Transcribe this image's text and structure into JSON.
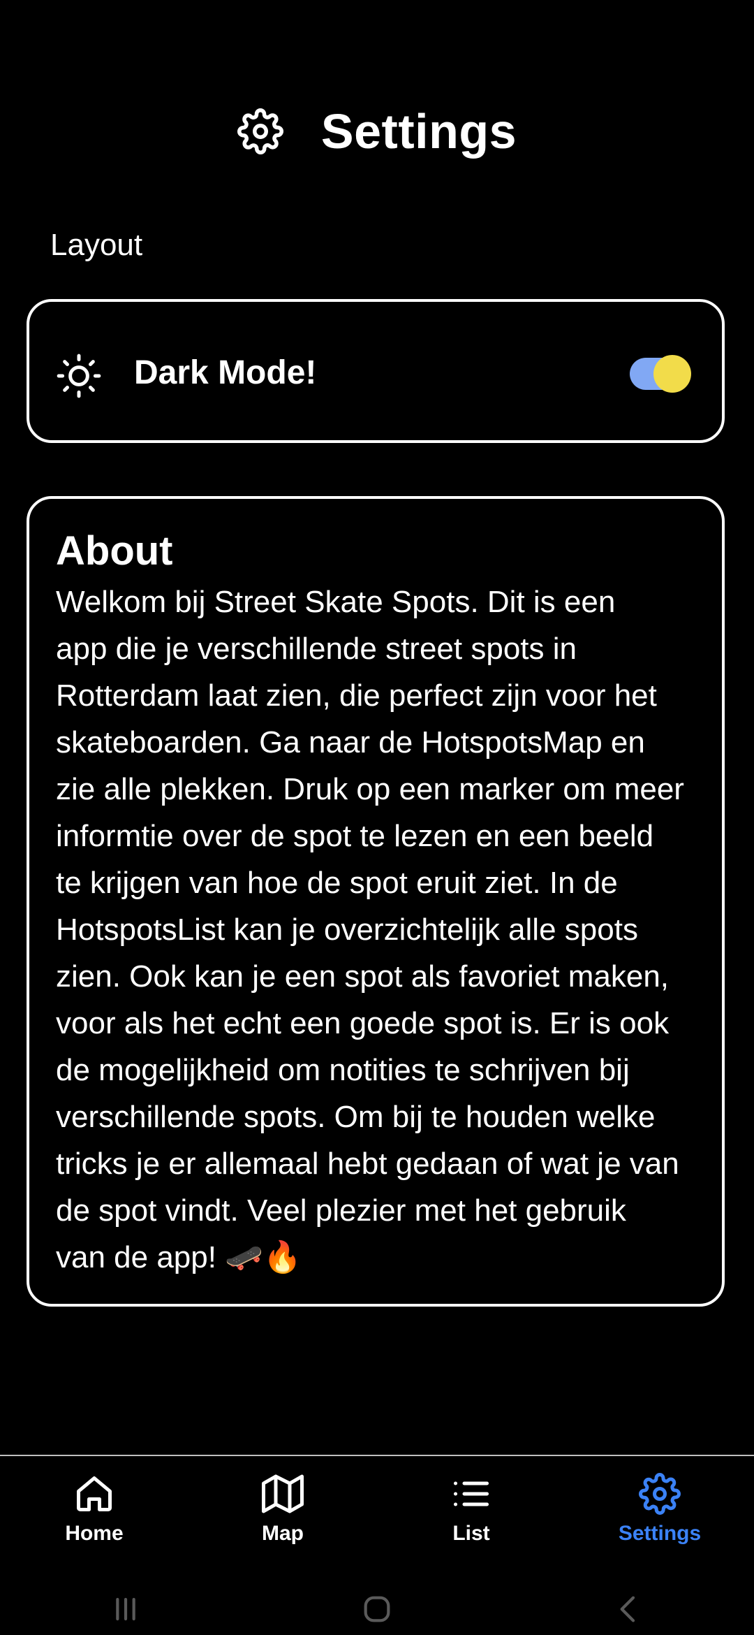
{
  "header": {
    "title": "Settings",
    "icon": "gear-icon"
  },
  "layout_section": {
    "label": "Layout"
  },
  "dark_mode": {
    "label": "Dark Mode!",
    "icon": "sun-icon",
    "enabled": true,
    "track_color": "#81a8f4",
    "thumb_color": "#f2dc4a"
  },
  "about": {
    "title": "About",
    "text": "Welkom bij Street Skate Spots. Dit is een\napp die je verschillende street spots in\nRotterdam laat zien, die perfect zijn voor het\nskateboarden. Ga naar de HotspotsMap en\nzie alle plekken. Druk op een marker om meer\ninformtie over de spot te lezen en een beeld\nte krijgen van hoe de spot eruit ziet. In de\nHotspotsList kan je overzichtelijk alle spots\nzien. Ook kan je een spot als favoriet maken,\nvoor als het echt een goede spot is. Er is ook\nde mogelijkheid om notities te schrijven bij\nverschillende spots. Om bij te houden welke\ntricks je er allemaal hebt gedaan of wat je van\nde spot vindt. Veel plezier met het gebruik\nvan de app! 🛹🔥"
  },
  "nav": {
    "items": [
      {
        "label": "Home",
        "icon": "home-icon"
      },
      {
        "label": "Map",
        "icon": "map-icon"
      },
      {
        "label": "List",
        "icon": "list-icon"
      },
      {
        "label": "Settings",
        "icon": "gear-icon",
        "active": true
      }
    ],
    "active_color": "#3b82f6"
  },
  "system_nav": {
    "buttons": [
      "recent-apps",
      "home",
      "back"
    ]
  }
}
